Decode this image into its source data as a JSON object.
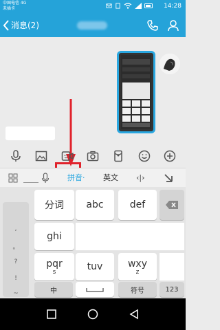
{
  "status_bar": {
    "carrier_line1": "中国电信 4G",
    "carrier_line2": "未插卡",
    "time": "14:28"
  },
  "title_bar": {
    "back_label": "消息(2)"
  },
  "keyboard_bar": {
    "pinyin": "拼音",
    "pinyin_suffix": "·",
    "english": "英文",
    "cursor": "‹|›"
  },
  "keys": {
    "k1_label": "分词",
    "k2_label": "abc",
    "k3_label": "def",
    "k4_label": "ghi",
    "k7_label": "pqr",
    "k7_sub": "s",
    "k8_label": "tuv",
    "k9_label": "wxy",
    "k9_sub": "z",
    "zh_label": "中",
    "symbol_label": "符号",
    "num_label": "123"
  },
  "symbols": [
    ",",
    "。",
    "?",
    "!",
    "~"
  ],
  "colors": {
    "accent": "#25a3d9",
    "highlight": "#e0222b"
  }
}
